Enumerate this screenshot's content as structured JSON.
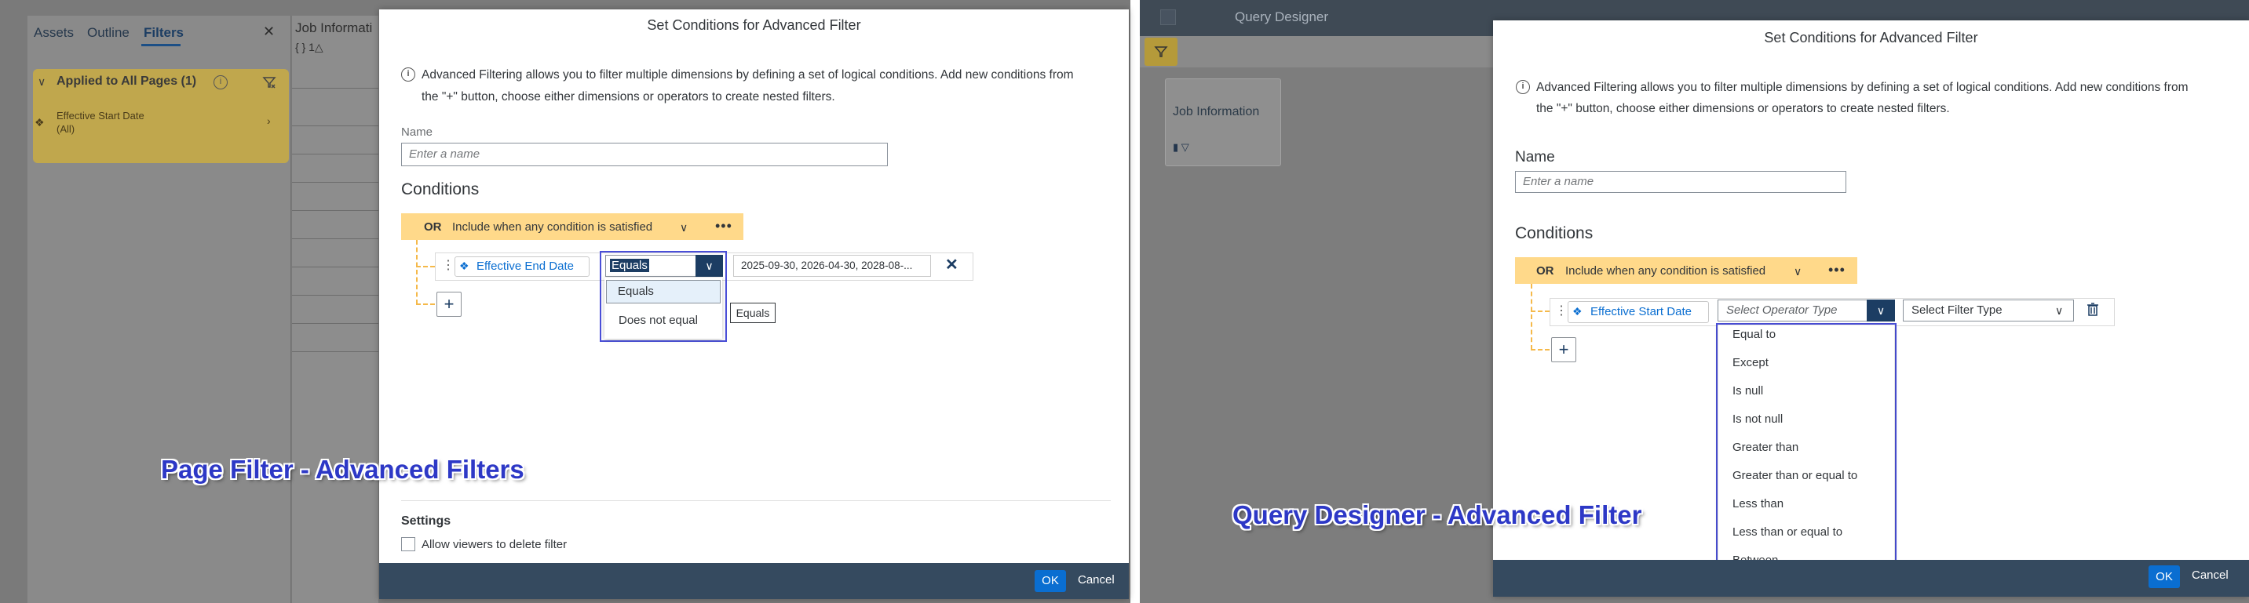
{
  "left": {
    "tabs": [
      "Assets",
      "Outline",
      "Filters"
    ],
    "close": "✕",
    "applied": {
      "title": "Applied to All Pages (1)",
      "info": "i",
      "item_name": "Effective Start Date",
      "item_value": "(All)"
    },
    "job_strip": {
      "title": "Job Informati",
      "icons": "{ } 1△"
    },
    "dialog": {
      "title": "Set Conditions for Advanced Filter",
      "info_line1": "Advanced Filtering allows you to filter multiple dimensions by defining a set of logical conditions. Add new conditions from",
      "info_line2": "the \"+\" button, choose either dimensions or operators to create nested filters.",
      "name_label": "Name",
      "name_placeholder": "Enter a name",
      "conditions_label": "Conditions",
      "or_label": "OR",
      "or_text": "Include when any condition is satisfied",
      "dimension": "Effective End Date",
      "operator_value": "Equals",
      "values_text": "2025-09-30, 2026-04-30, 2028-08-...",
      "dropdown_options": [
        "Equals",
        "Does not equal"
      ],
      "tooltip": "Equals",
      "settings_label": "Settings",
      "allow_delete_label": "Allow viewers to delete filter",
      "ok_label": "OK",
      "cancel_label": "Cancel"
    },
    "caption": "Page Filter - Advanced Filters"
  },
  "right": {
    "header_title": "Query Designer",
    "job_card_title": "Job Information",
    "dialog": {
      "title": "Set Conditions for Advanced Filter",
      "info_line1": "Advanced Filtering allows you to filter multiple dimensions by defining a set of logical conditions. Add new conditions from",
      "info_line2": "the \"+\" button, choose either dimensions or operators to create nested filters.",
      "name_label": "Name",
      "name_placeholder": "Enter a name",
      "conditions_label": "Conditions",
      "or_label": "OR",
      "or_text": "Include when any condition is satisfied",
      "dimension": "Effective Start Date",
      "operator_placeholder": "Select Operator Type",
      "filter_type_placeholder": "Select Filter Type",
      "operator_options": [
        "Equal to",
        "Except",
        "Is null",
        "Is not null",
        "Greater than",
        "Greater than or equal to",
        "Less than",
        "Less than or equal to",
        "Between"
      ],
      "ok_label": "OK",
      "cancel_label": "Cancel"
    },
    "caption": "Query Designer - Advanced Filter"
  },
  "colors": {
    "accent_blue": "#0a6ed1",
    "dark_blue": "#1c3d63",
    "or_yellow": "#ffd98a",
    "callout_border": "#4a4fd8",
    "caption_text": "#2d38c6",
    "footer_bar": "#354a5f"
  }
}
